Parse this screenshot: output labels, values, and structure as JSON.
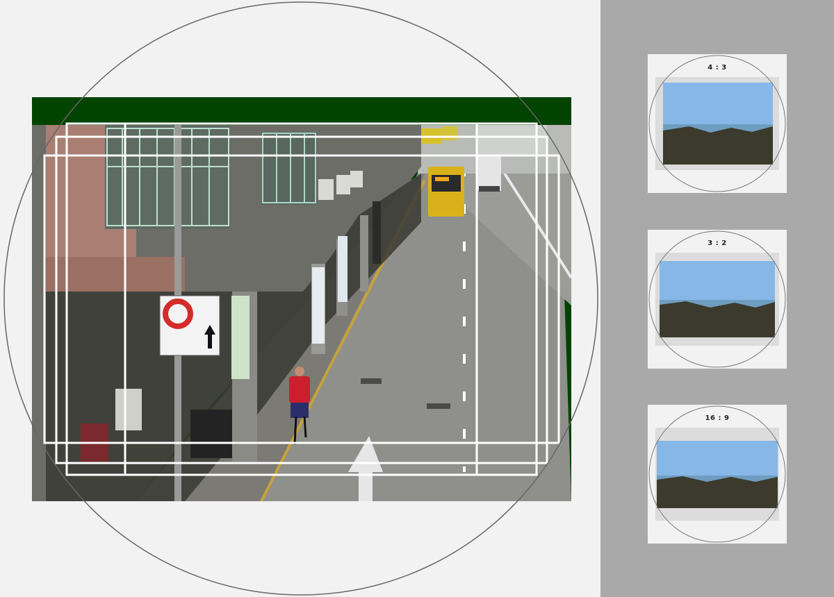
{
  "preview": {
    "frame_color": "#014300",
    "image_circle_color": "#666666",
    "guide_color": "#ffffff",
    "photo_subject": "street-scene-photo"
  },
  "aspect_presets": [
    {
      "label": "4 : 3",
      "icon": "seascape-thumbnail"
    },
    {
      "label": "3 : 2",
      "icon": "seascape-thumbnail"
    },
    {
      "label": "16 : 9",
      "icon": "seascape-thumbnail"
    }
  ],
  "colors": {
    "panel_background": "#a9a9a9",
    "card_background": "#f2f2f2",
    "sky": "#86b7e6",
    "sea": "#6f9dc2",
    "rocks": "#3b3a2c"
  }
}
